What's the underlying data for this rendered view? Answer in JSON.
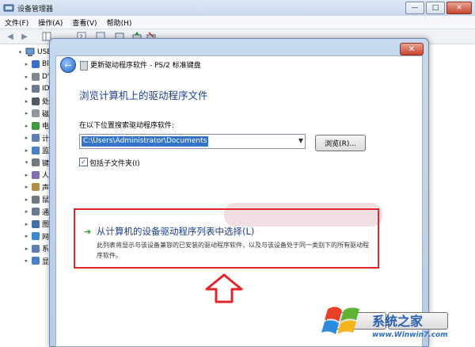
{
  "window": {
    "title": "设备管理器",
    "controls": {
      "minimize": "—",
      "maximize": "□",
      "close": "✕"
    }
  },
  "menubar": [
    {
      "label": "文件(F)"
    },
    {
      "label": "操作(A)"
    },
    {
      "label": "查看(V)"
    },
    {
      "label": "帮助(H)"
    }
  ],
  "tree": {
    "root_label": "USER",
    "items": [
      {
        "label": "Bl",
        "icon": "bluetooth-icon",
        "color": "#3a6fc8"
      },
      {
        "label": "D'",
        "icon": "disk-drive-icon",
        "color": "#808890"
      },
      {
        "label": "ID",
        "icon": "ide-controller-icon",
        "color": "#6a7a90"
      },
      {
        "label": "处",
        "icon": "processor-icon",
        "color": "#505860"
      },
      {
        "label": "磁",
        "icon": "disk-icon",
        "color": "#9098a0"
      },
      {
        "label": "电",
        "icon": "battery-icon",
        "color": "#3c9c3c"
      },
      {
        "label": "计",
        "icon": "computer-icon",
        "color": "#5a7fb0"
      },
      {
        "label": "监",
        "icon": "monitor-icon",
        "color": "#4a80c8"
      },
      {
        "label": "键",
        "icon": "keyboard-icon",
        "color": "#707880"
      },
      {
        "label": "人",
        "icon": "hid-icon",
        "color": "#8070b0"
      },
      {
        "label": "声",
        "icon": "sound-icon",
        "color": "#b09040"
      },
      {
        "label": "鼠",
        "icon": "mouse-icon",
        "color": "#707880"
      },
      {
        "label": "通",
        "icon": "usb-icon",
        "color": "#6a7a90"
      },
      {
        "label": "图",
        "icon": "imaging-icon",
        "color": "#4070a0"
      },
      {
        "label": "网",
        "icon": "network-icon",
        "color": "#3a8ad0"
      },
      {
        "label": "系",
        "icon": "system-icon",
        "color": "#5a7fb0"
      },
      {
        "label": "显",
        "icon": "display-adapter-icon",
        "color": "#4a80c8"
      }
    ]
  },
  "dialog": {
    "title": "更新驱动程序软件 - PS/2 标准键盘",
    "close": "✕",
    "back": "←",
    "heading": "浏览计算机上的驱动程序文件",
    "search_label": "在以下位置搜索驱动程序软件:",
    "path_value": "C:\\Users\\Administrator\\Documents",
    "combo_arrow": "▼",
    "browse_label": "浏览(R)...",
    "include_subfolders_label": "包括子文件夹(I)",
    "include_subfolders_checked": "✓",
    "option_arrow": "➔",
    "option_title": "从计算机的设备驱动程序列表中选择(L)",
    "option_description": "此列表将显示与该设备兼容的已安装的驱动程序软件，以及与该设备处于同一类别下的所有驱动程序软件。",
    "highlight_color": "#e0262b"
  },
  "watermark": {
    "brand": "系统之家",
    "url": "www.Winwin7.com"
  }
}
